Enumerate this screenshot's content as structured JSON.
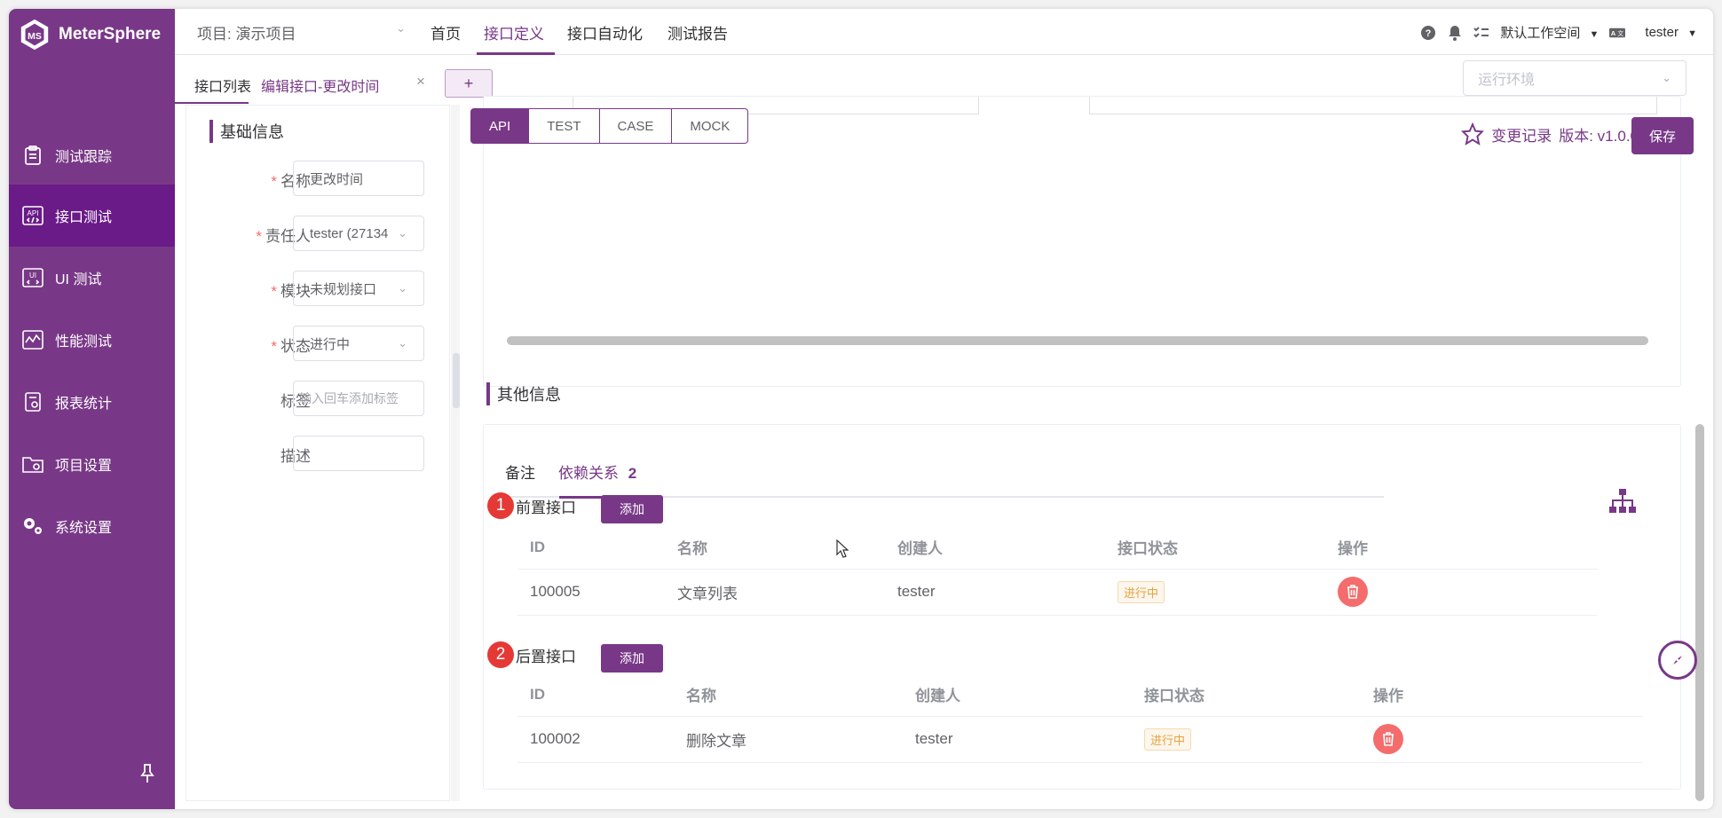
{
  "app": {
    "name": "MeterSphere"
  },
  "sidebar": {
    "items": [
      {
        "label": "测试跟踪",
        "icon": "clipboard-icon"
      },
      {
        "label": "接口测试",
        "icon": "api-icon",
        "active": true
      },
      {
        "label": "UI 测试",
        "icon": "ui-icon"
      },
      {
        "label": "性能测试",
        "icon": "performance-chart-icon"
      },
      {
        "label": "报表统计",
        "icon": "report-icon"
      },
      {
        "label": "项目设置",
        "icon": "folder-settings-icon"
      },
      {
        "label": "系统设置",
        "icon": "gears-icon"
      }
    ]
  },
  "header": {
    "project": "项目: 演示项目",
    "nav": [
      "首页",
      "接口定义",
      "接口自动化",
      "测试报告"
    ],
    "active_nav": "接口定义",
    "workspace": "默认工作空间",
    "user": "tester"
  },
  "tabs": {
    "list": "接口列表",
    "edit": "编辑接口-更改时间",
    "close": "×",
    "add": "+",
    "env_placeholder": "运行环境"
  },
  "basic_info": {
    "title": "基础信息",
    "fields": {
      "name": {
        "label": "名称",
        "value": "更改时间"
      },
      "owner": {
        "label": "责任人",
        "value": "tester (27134"
      },
      "module": {
        "label": "模块",
        "value": "未规划接口"
      },
      "status": {
        "label": "状态",
        "value": "进行中"
      },
      "tags": {
        "label": "标签",
        "placeholder": "输入回车添加标签"
      },
      "description": {
        "label": "描述",
        "value": ""
      }
    }
  },
  "editor": {
    "modes": [
      "API",
      "TEST",
      "CASE",
      "MOCK"
    ],
    "active_mode": "API",
    "changelog": "变更记录",
    "version": "版本: v1.0.0",
    "save": "保存"
  },
  "other_info": {
    "title": "其他信息",
    "tabs": {
      "remark": "备注",
      "dependency": "依赖关系",
      "dependency_count": "2"
    },
    "pre": {
      "badge": "1",
      "title": "前置接口",
      "add": "添加",
      "columns": [
        "ID",
        "名称",
        "创建人",
        "接口状态",
        "操作"
      ],
      "rows": [
        {
          "id": "100005",
          "name": "文章列表",
          "creator": "tester",
          "status": "进行中"
        }
      ]
    },
    "post": {
      "badge": "2",
      "title": "后置接口",
      "add": "添加",
      "columns": [
        "ID",
        "名称",
        "创建人",
        "接口状态",
        "操作"
      ],
      "rows": [
        {
          "id": "100002",
          "name": "删除文章",
          "creator": "tester",
          "status": "进行中"
        }
      ]
    }
  },
  "colors": {
    "brand": "#783887",
    "danger": "#f56c6c",
    "warning": "#e6a23c"
  }
}
